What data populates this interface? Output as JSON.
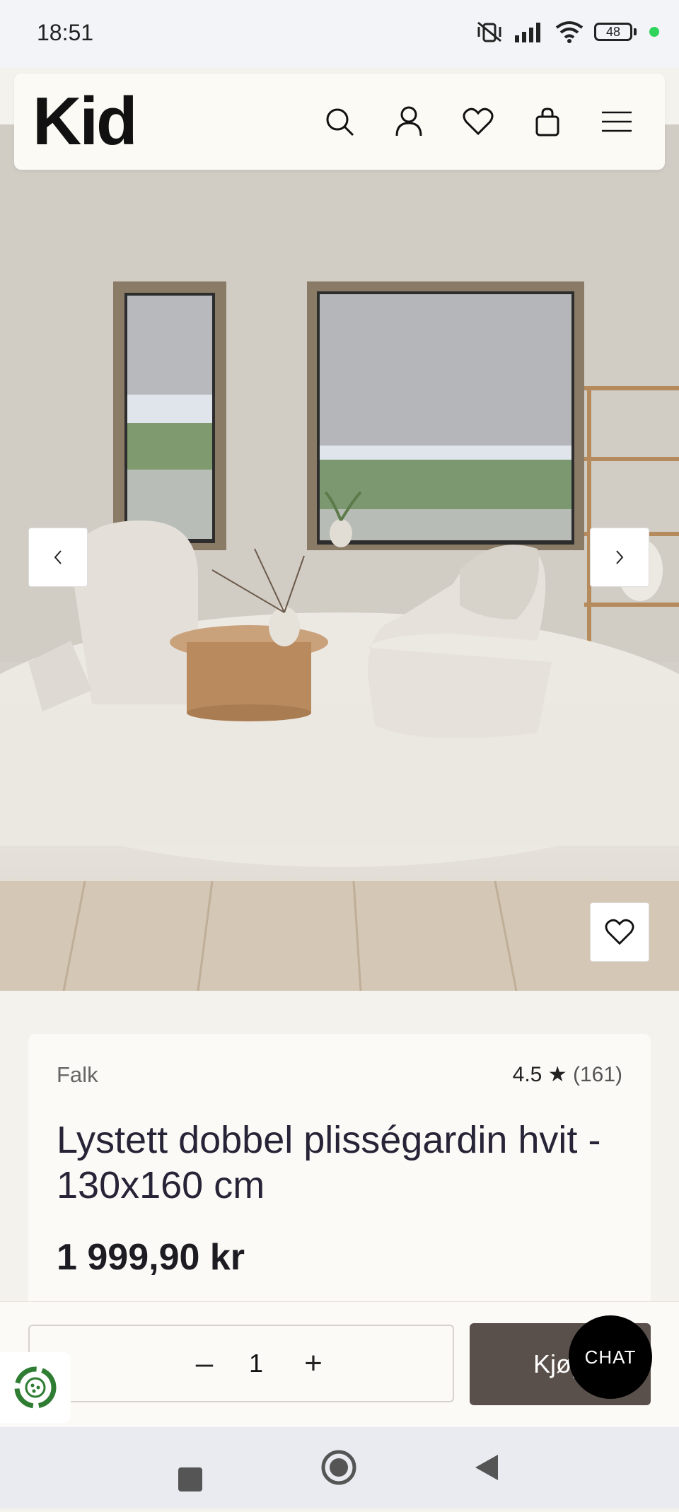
{
  "status_bar": {
    "time": "18:51",
    "battery": "48"
  },
  "header": {
    "logo": "Kid",
    "icons": [
      "search-icon",
      "account-icon",
      "wishlist-icon",
      "cart-icon",
      "menu-icon"
    ]
  },
  "gallery": {
    "prev_icon": "chevron-left-icon",
    "next_icon": "chevron-right-icon",
    "favorite_icon": "heart-icon"
  },
  "product": {
    "brand": "Falk",
    "rating": "4.5",
    "rating_star": "★",
    "review_count": "(161)",
    "title": "Lystett dobbel plisségardin hvit - 130x160 cm",
    "price": "1 999,90 kr"
  },
  "purchase": {
    "minus": "–",
    "quantity": "1",
    "plus": "+",
    "buy_label": "Kjøp"
  },
  "chat": {
    "label": "CHAT"
  },
  "colors": {
    "buy_button": "#5a504b",
    "chat_button": "#000000",
    "eco_badge": "#2e7d32"
  }
}
